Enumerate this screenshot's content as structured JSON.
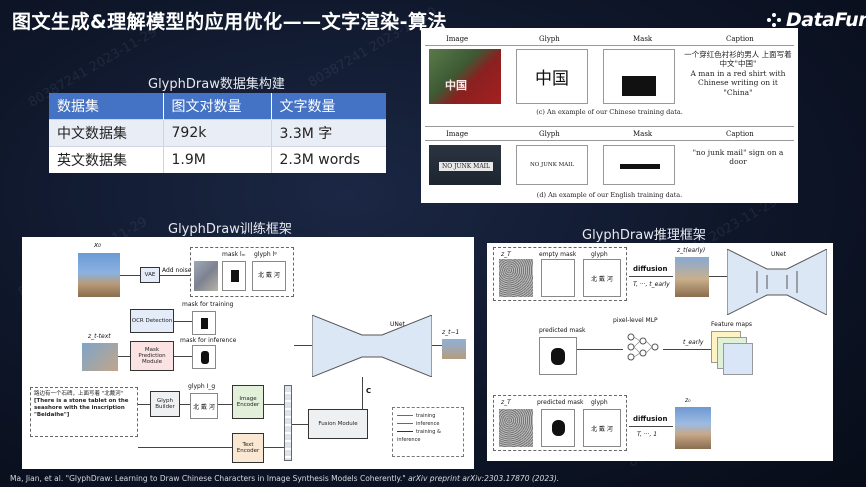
{
  "title": "图文生成&理解模型的应用优化——文字渲染-算法",
  "logo": {
    "text": "DataFun."
  },
  "dataset": {
    "title": "GlyphDraw数据集构建",
    "headers": [
      "数据集",
      "图文对数量",
      "文字数量"
    ],
    "rows": [
      [
        "中文数据集",
        "792k",
        "3.3M 字"
      ],
      [
        "英文数据集",
        "1.9M",
        "2.3M words"
      ]
    ]
  },
  "training_examples": {
    "columns": [
      "Image",
      "Glyph",
      "Mask",
      "Caption"
    ],
    "chinese": {
      "image_text": "中国",
      "glyph": "中国",
      "caption_cn": "一个穿红色衬衫的男人 上面写着中文\"中国\"",
      "caption_en": "A man in a red shirt with Chinese writing on it \"China\"",
      "label": "(c) An example of our Chinese training data."
    },
    "english": {
      "sign_text": "NO JUNK MAIL",
      "glyph": "NO JUNK MAIL",
      "caption": "\"no junk mail\" sign on a door",
      "label": "(d) An example of our English training data."
    }
  },
  "training_framework": {
    "title": "GlyphDraw训练框架",
    "labels": {
      "x0": "x₀",
      "vae": "VAE",
      "add_noise": "Add noise",
      "mask": "mask  lₘ",
      "glyph": "glyph  lᵍ",
      "glyph_text": "北 戴 河",
      "ocr": "OCR Detection",
      "mask_training": "mask for training",
      "zt_caption": "z_t-text",
      "mask_pred": "Mask Prediction Module",
      "mask_inference": "mask for inference",
      "prompt_cn": "路边有一个石碑，上面写着 \"北戴河\"",
      "prompt_en": "[There is a stone tablet on the seashore with the inscription \"Beidaihe\"]",
      "glyph_builder": "Glyph Builder",
      "glyph_ig": "glyph  I_g",
      "image_encoder": "Image Encoder",
      "text_encoder": "Text Encoder",
      "fusion": "Fusion Module",
      "unet": "UNet",
      "c": "C",
      "output": "z_t−1",
      "legend": [
        "training",
        "inference",
        "training & inference"
      ]
    }
  },
  "inference_framework": {
    "title": "GlyphDraw推理框架",
    "labels": {
      "zT": "z_T",
      "empty_mask": "empty mask",
      "glyph": "glyph",
      "glyph_text": "北 戴 河",
      "diffusion": "diffusion",
      "steps": "T, ···, t_early",
      "zt_early": "z_t(early)",
      "unet": "UNet",
      "mlp": "pixel-level MLP",
      "feature_maps": "Feature maps",
      "predicted_mask": "predicted mask",
      "t_early": "t_early",
      "zT2": "z_T",
      "predicted_mask2": "predicted mask",
      "glyph2": "glyph",
      "diffusion2": "diffusion",
      "steps2": "T, ···, 1",
      "z0": "z₀"
    }
  },
  "citation": {
    "main": "Ma, Jian, et al. \"GlyphDraw: Learning to Draw Chinese Characters in Image Synthesis Models Coherently.\"",
    "source": "arXiv preprint arXiv:2303.17870 (2023)."
  },
  "watermark": {
    "text": "80387241  2023-11-29"
  },
  "colors": {
    "accent": "#4472c4",
    "background": "#0e1629"
  }
}
